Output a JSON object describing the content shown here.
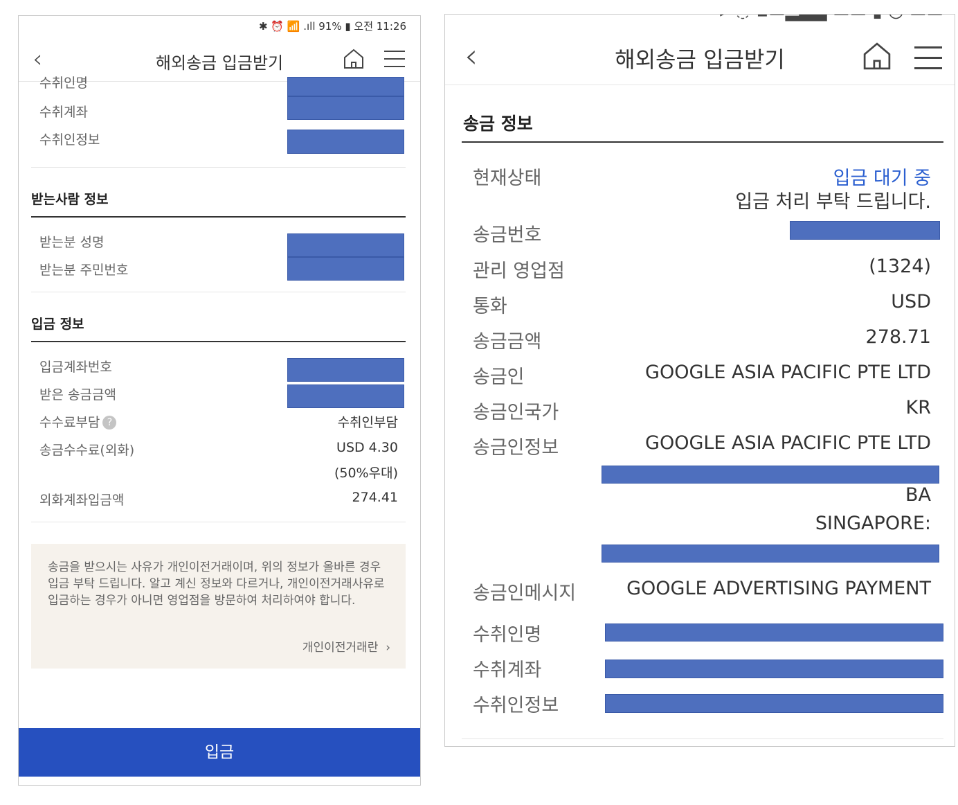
{
  "left": {
    "status_bar": "✱ ⏰ 📶 .ıll 91% ▮ 오전 11:26",
    "header_title": "해외송금 입금받기",
    "cut_rows": [
      "수취인명",
      "수취계좌",
      "수취인정보"
    ],
    "recipient_section_title": "받는사람 정보",
    "recipient_rows": [
      "받는분 성명",
      "받는분 주민번호"
    ],
    "deposit_section_title": "입금 정보",
    "deposit_rows": {
      "account_label": "입금계좌번호",
      "received_label": "받은 송금금액",
      "fee_bearer_label": "수수료부담",
      "fee_bearer_value": "수취인부담",
      "fee_label": "송금수수료(외화)",
      "fee_value": "USD 4.30",
      "fee_discount": "(50%우대)",
      "fx_deposit_label": "외화계좌입금액",
      "fx_deposit_value": "274.41"
    },
    "notice_text": "송금을 받으시는 사유가 개인이전거래이며, 위의 정보가 올바른 경우 입금 부탁 드립니다. 알고 계신 정보와 다르거나, 개인이전거래사유로 입금하는 경우가 아니면 영업점을 방문하여 처리하여야 합니다.",
    "notice_link": "개인이전거래란",
    "deposit_button": "입금"
  },
  "right": {
    "header_title": "해외송금 입금받기",
    "section_title": "송금 정보",
    "status_label": "현재상태",
    "status_value": "입금 대기 중",
    "status_note": "입금 처리 부탁 드립니다.",
    "remit_no_label": "송금번호",
    "branch_label": "관리 영업점",
    "branch_value": "(1324)",
    "currency_label": "통화",
    "currency_value": "USD",
    "amount_label": "송금금액",
    "amount_value": "278.71",
    "sender_label": "송금인",
    "sender_value": "GOOGLE ASIA PACIFIC PTE LTD",
    "sender_country_label": "송금인국가",
    "sender_country_value": "KR",
    "sender_info_label": "송금인정보",
    "sender_info_value": "GOOGLE ASIA PACIFIC PTE LTD",
    "sender_info_line2": "BA",
    "sender_info_line3": "SINGAPORE:",
    "message_label": "송금인메시지",
    "message_value": "GOOGLE ADVERTISING PAYMENT",
    "payee_name_label": "수취인명",
    "payee_account_label": "수취계좌",
    "payee_info_label": "수취인정보"
  },
  "colors": {
    "accent_blue": "#2650bf",
    "status_blue": "#2b5fd0",
    "redaction": "#4e6fbe"
  }
}
